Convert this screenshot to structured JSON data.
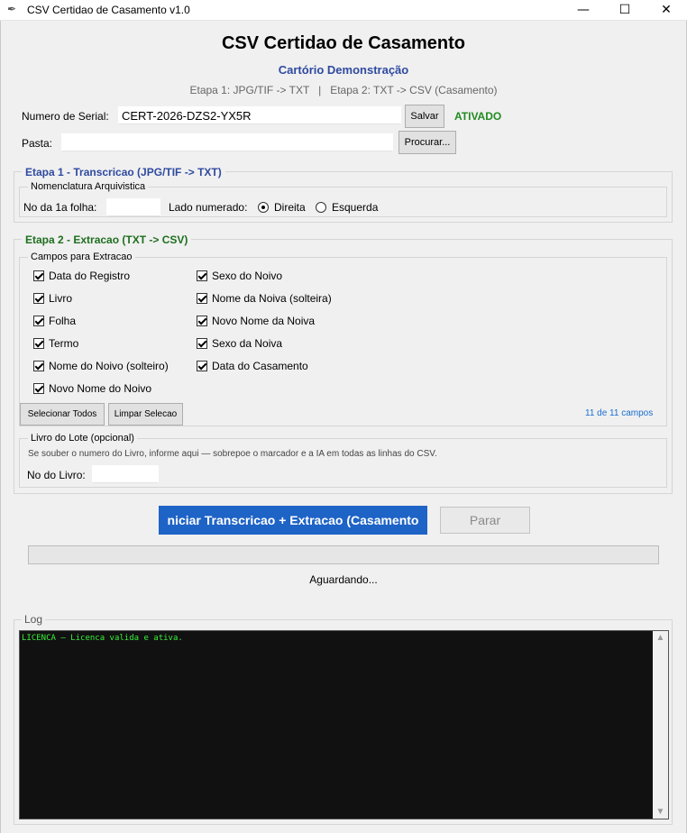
{
  "window": {
    "title": "CSV Certidao de Casamento v1.0",
    "minimize": "—",
    "maximize": "☐",
    "close": "✕",
    "app_icon": "feather-icon"
  },
  "header": {
    "title": "CSV Certidao de Casamento",
    "subtitle": "Cartório Demonstração",
    "steps": "Etapa 1: JPG/TIF -> TXT   |   Etapa 2: TXT -> CSV (Casamento)"
  },
  "license": {
    "label": "Numero de Serial:",
    "value": "CERT-2026-DZS2-YX5R",
    "save_label": "Salvar",
    "status": "ATIVADO",
    "status_color": "#228b22"
  },
  "folder": {
    "label": "Pasta:",
    "value": "",
    "browse_label": "Procurar..."
  },
  "step1": {
    "title": "Etapa 1 - Transcricao  (JPG/TIF -> TXT)",
    "title_color": "#2f4aa0",
    "nomenclature_title": "Nomenclatura Arquivistica",
    "first_sheet_label": "No da 1a folha:",
    "first_sheet_value": "",
    "side_label": "Lado numerado:",
    "side_options": [
      "Direita",
      "Esquerda"
    ],
    "side_selected": "Direita"
  },
  "step2": {
    "title": "Etapa 2 - Extracao  (TXT -> CSV)",
    "title_color": "#1e6e1e",
    "fields_title": "Campos para Extracao",
    "fields_col1": [
      "Data do Registro",
      "Livro",
      "Folha",
      "Termo",
      "Nome do Noivo (solteiro)",
      "Novo Nome do Noivo"
    ],
    "fields_col2": [
      "Sexo do Noivo",
      "Nome da Noiva (solteira)",
      "Novo Nome da Noiva",
      "Sexo da Noiva",
      "Data do Casamento"
    ],
    "select_all_label": "Selecionar Todos",
    "clear_label": "Limpar Selecao",
    "count_text": "11 de 11 campos",
    "count_color": "#1a6fd1",
    "lot_title": "Livro do Lote (opcional)",
    "lot_hint": "Se souber o numero do Livro, informe aqui — sobrepoe o marcador e a IA em todas as linhas do CSV.",
    "lot_label": "No do Livro:",
    "lot_value": ""
  },
  "actions": {
    "start_label": "niciar Transcricao + Extracao (Casamento",
    "start_color": "#1e63c6",
    "stop_label": "Parar",
    "progress": 0,
    "status": "Aguardando..."
  },
  "log": {
    "title": "Log",
    "lines": [
      "LICENCA — Licenca valida e ativa."
    ],
    "text_color": "#38f138",
    "scroll_up": "▲",
    "scroll_down": "▼"
  }
}
